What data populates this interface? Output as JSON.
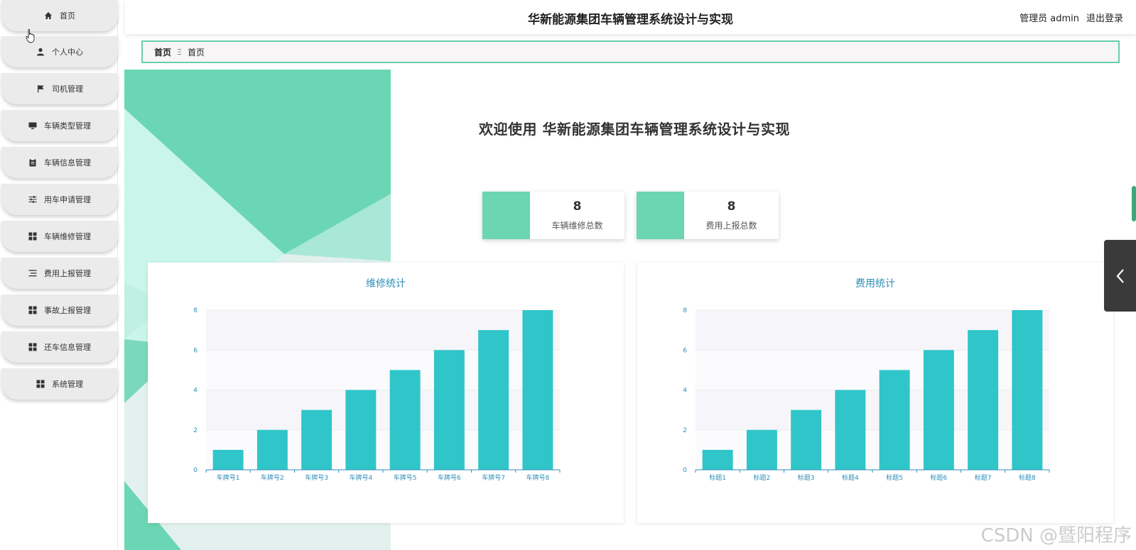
{
  "sidebar": {
    "items": [
      {
        "label": "首页",
        "icon": "home-icon"
      },
      {
        "label": "个人中心",
        "icon": "user-icon"
      },
      {
        "label": "司机管理",
        "icon": "flag-icon"
      },
      {
        "label": "车辆类型管理",
        "icon": "monitor-icon"
      },
      {
        "label": "车辆信息管理",
        "icon": "clipboard-icon"
      },
      {
        "label": "用车申请管理",
        "icon": "sliders-icon"
      },
      {
        "label": "车辆维修管理",
        "icon": "grid-icon"
      },
      {
        "label": "费用上报管理",
        "icon": "list-icon"
      },
      {
        "label": "事故上报管理",
        "icon": "grid-icon"
      },
      {
        "label": "还车信息管理",
        "icon": "grid-icon"
      },
      {
        "label": "系统管理",
        "icon": "grid-icon"
      }
    ]
  },
  "header": {
    "title": "华新能源集团车辆管理系统设计与实现",
    "user": "管理员 admin",
    "logout": "退出登录"
  },
  "breadcrumb": {
    "home": "首页",
    "separator": "Ξ",
    "current": "首页"
  },
  "welcome": "欢迎使用 华新能源集团车辆管理系统设计与实现",
  "stats": [
    {
      "value": "8",
      "label": "车辆维修总数"
    },
    {
      "value": "8",
      "label": "费用上报总数"
    }
  ],
  "colors": {
    "accent": "#6cd5b1",
    "bar": "#30c6c9",
    "chart_title": "#2e8fb8"
  },
  "chart_data": [
    {
      "type": "bar",
      "title": "维修统计",
      "categories": [
        "车牌号1",
        "车牌号2",
        "车牌号3",
        "车牌号4",
        "车牌号5",
        "车牌号6",
        "车牌号7",
        "车牌号8"
      ],
      "values": [
        1,
        2,
        3,
        4,
        5,
        6,
        7,
        8
      ],
      "yticks": [
        0,
        2,
        4,
        6,
        8
      ],
      "ylim": [
        0,
        8
      ],
      "xlabel": "",
      "ylabel": ""
    },
    {
      "type": "bar",
      "title": "费用统计",
      "categories": [
        "标题1",
        "标题2",
        "标题3",
        "标题4",
        "标题5",
        "标题6",
        "标题7",
        "标题8"
      ],
      "values": [
        1,
        2,
        3,
        4,
        5,
        6,
        7,
        8
      ],
      "yticks": [
        0,
        2,
        4,
        6,
        8
      ],
      "ylim": [
        0,
        8
      ],
      "xlabel": "",
      "ylabel": ""
    }
  ],
  "watermark": "CSDN @暨阳程序"
}
